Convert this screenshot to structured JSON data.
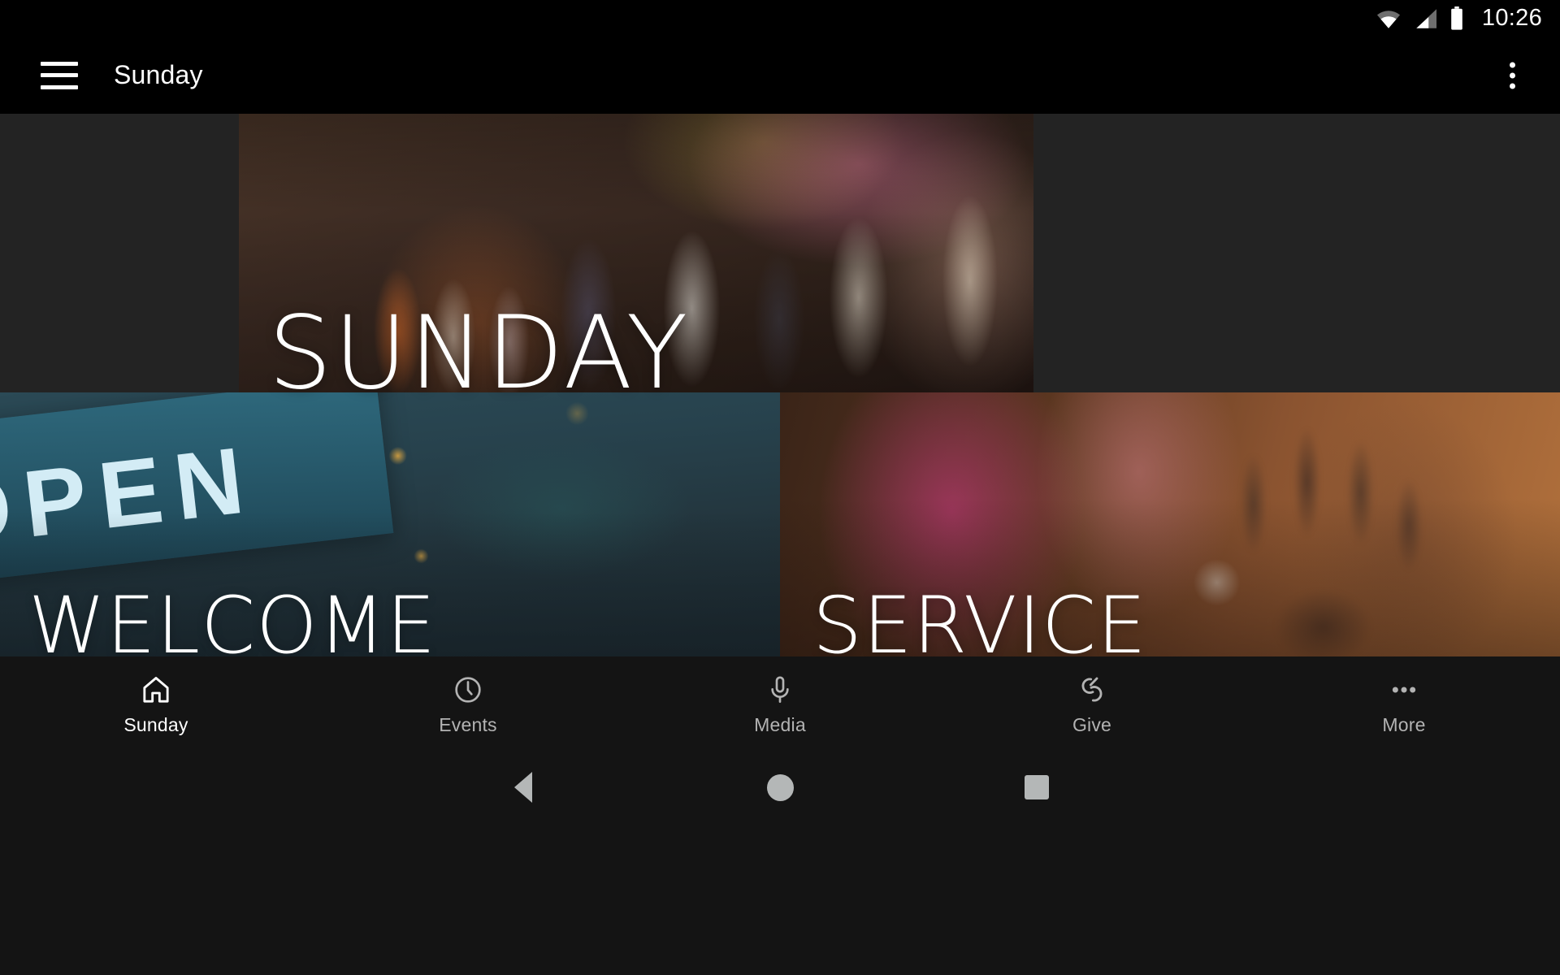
{
  "status_bar": {
    "time": "10:26",
    "icons": [
      "wifi-icon",
      "cellular-signal-icon",
      "battery-icon"
    ]
  },
  "app_bar": {
    "menu_icon": "hamburger-menu-icon",
    "title": "Sunday",
    "overflow_icon": "overflow-menu-icon"
  },
  "hero": {
    "title": "SUNDAY",
    "image_alt": "worship-team-singing-on-stage"
  },
  "tiles": [
    {
      "label": "WELCOME",
      "sign_text": "OPEN",
      "image_alt": "open-sign-hanging-on-chain"
    },
    {
      "label": "SERVICE",
      "image_alt": "raised-hand-in-worship"
    }
  ],
  "bottom_nav": {
    "active_index": 0,
    "items": [
      {
        "label": "Sunday",
        "icon": "home-icon"
      },
      {
        "label": "Events",
        "icon": "clock-icon"
      },
      {
        "label": "Media",
        "icon": "microphone-icon"
      },
      {
        "label": "Give",
        "icon": "giving-hands-icon"
      },
      {
        "label": "More",
        "icon": "more-dots-icon"
      }
    ]
  },
  "system_nav": {
    "back": "back-triangle-icon",
    "home": "home-circle-icon",
    "recents": "recents-square-icon"
  },
  "colors": {
    "bar_background": "#000000",
    "nav_background": "#141414",
    "content_letterbox": "#232323",
    "active_text": "#ffffff",
    "inactive_text": "#b3b3b3",
    "system_icon": "#b4b7b7"
  }
}
